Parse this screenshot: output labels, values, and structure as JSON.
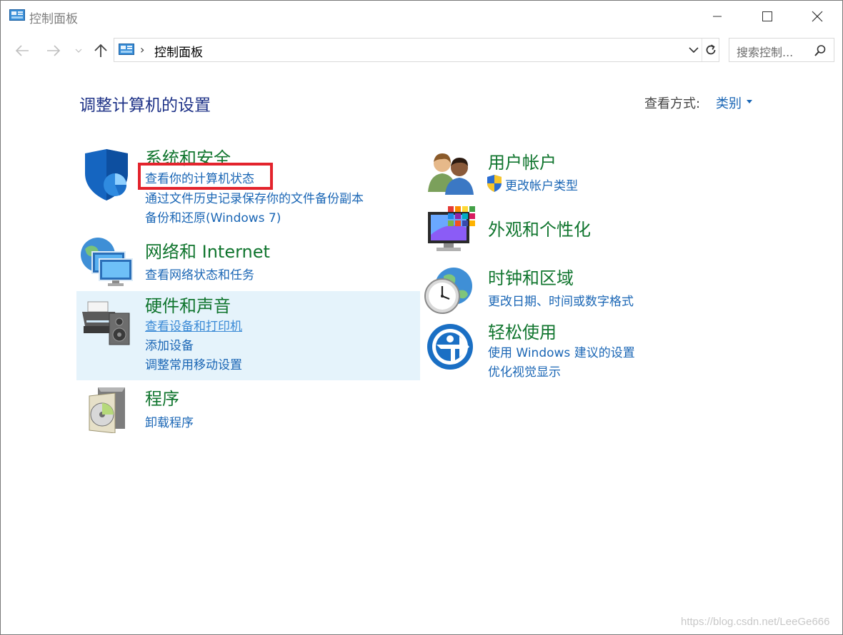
{
  "window": {
    "title": "控制面板"
  },
  "address": {
    "breadcrumb_separator": "›",
    "path": "控制面板",
    "search_placeholder": "搜索控制..."
  },
  "header": {
    "title": "调整计算机的设置",
    "view_by_label": "查看方式:",
    "view_by_value": "类别"
  },
  "categories": {
    "system": {
      "title": "系统和安全",
      "links": [
        "查看你的计算机状态",
        "通过文件历史记录保存你的文件备份副本",
        "备份和还原(Windows 7)"
      ]
    },
    "network": {
      "title": "网络和 Internet",
      "links": [
        "查看网络状态和任务"
      ]
    },
    "hardware": {
      "title": "硬件和声音",
      "links": [
        "查看设备和打印机",
        "添加设备",
        "调整常用移动设置"
      ]
    },
    "programs": {
      "title": "程序",
      "links": [
        "卸载程序"
      ]
    },
    "users": {
      "title": "用户帐户",
      "links": [
        "更改帐户类型"
      ]
    },
    "appearance": {
      "title": "外观和个性化",
      "links": []
    },
    "clock": {
      "title": "时钟和区域",
      "links": [
        "更改日期、时间或数字格式"
      ]
    },
    "ease": {
      "title": "轻松使用",
      "links": [
        "使用 Windows 建议的设置",
        "优化视觉显示"
      ]
    }
  },
  "watermark": "https://blog.csdn.net/LeeGe666",
  "colors": {
    "title_blue": "#1e3287",
    "category_green": "#10752e",
    "link_blue": "#1a66b5",
    "hover_bg": "#e5f3fb",
    "highlight_red": "#e3232c"
  }
}
